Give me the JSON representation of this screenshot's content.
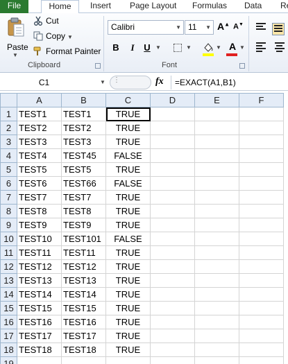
{
  "tabs": [
    {
      "id": "file",
      "label": "File",
      "active": false
    },
    {
      "id": "home",
      "label": "Home",
      "active": true
    },
    {
      "id": "insert",
      "label": "Insert",
      "active": false
    },
    {
      "id": "pagelayout",
      "label": "Page Layout",
      "active": false
    },
    {
      "id": "formulas",
      "label": "Formulas",
      "active": false
    },
    {
      "id": "data",
      "label": "Data",
      "active": false
    },
    {
      "id": "review",
      "label": "Re",
      "active": false
    }
  ],
  "clipboard": {
    "group_label": "Clipboard",
    "paste_label": "Paste",
    "cut_label": "Cut",
    "copy_label": "Copy",
    "format_painter_label": "Format Painter"
  },
  "font": {
    "group_label": "Font",
    "font_name": "Calibri",
    "font_size": "11",
    "bold": "B",
    "italic": "I",
    "underline": "U",
    "font_color_letter": "A",
    "fill_color": "#ffff00",
    "font_color": "#e02020"
  },
  "formula_bar": {
    "name_box": "C1",
    "fx": "fx",
    "formula": "=EXACT(A1,B1)"
  },
  "sheet": {
    "columns": [
      "A",
      "B",
      "C",
      "D",
      "E",
      "F"
    ],
    "rows": [
      {
        "n": "1",
        "a": "TEST1",
        "b": "TEST1",
        "c": "TRUE"
      },
      {
        "n": "2",
        "a": "TEST2",
        "b": "TEST2",
        "c": "TRUE"
      },
      {
        "n": "3",
        "a": "TEST3",
        "b": "TEST3",
        "c": "TRUE"
      },
      {
        "n": "4",
        "a": "TEST4",
        "b": "TEST45",
        "c": "FALSE"
      },
      {
        "n": "5",
        "a": "TEST5",
        "b": "TEST5",
        "c": "TRUE"
      },
      {
        "n": "6",
        "a": "TEST6",
        "b": "TEST66",
        "c": "FALSE"
      },
      {
        "n": "7",
        "a": "TEST7",
        "b": "TEST7",
        "c": "TRUE"
      },
      {
        "n": "8",
        "a": "TEST8",
        "b": "TEST8",
        "c": "TRUE"
      },
      {
        "n": "9",
        "a": "TEST9",
        "b": "TEST9",
        "c": "TRUE"
      },
      {
        "n": "10",
        "a": "TEST10",
        "b": "TEST101",
        "c": "FALSE"
      },
      {
        "n": "11",
        "a": "TEST11",
        "b": "TEST11",
        "c": "TRUE"
      },
      {
        "n": "12",
        "a": "TEST12",
        "b": "TEST12",
        "c": "TRUE"
      },
      {
        "n": "13",
        "a": "TEST13",
        "b": "TEST13",
        "c": "TRUE"
      },
      {
        "n": "14",
        "a": "TEST14",
        "b": "TEST14",
        "c": "TRUE"
      },
      {
        "n": "15",
        "a": "TEST15",
        "b": "TEST15",
        "c": "TRUE"
      },
      {
        "n": "16",
        "a": "TEST16",
        "b": "TEST16",
        "c": "TRUE"
      },
      {
        "n": "17",
        "a": "TEST17",
        "b": "TEST17",
        "c": "TRUE"
      },
      {
        "n": "18",
        "a": "TEST18",
        "b": "TEST18",
        "c": "TRUE"
      },
      {
        "n": "19",
        "a": "",
        "b": "",
        "c": ""
      }
    ]
  }
}
